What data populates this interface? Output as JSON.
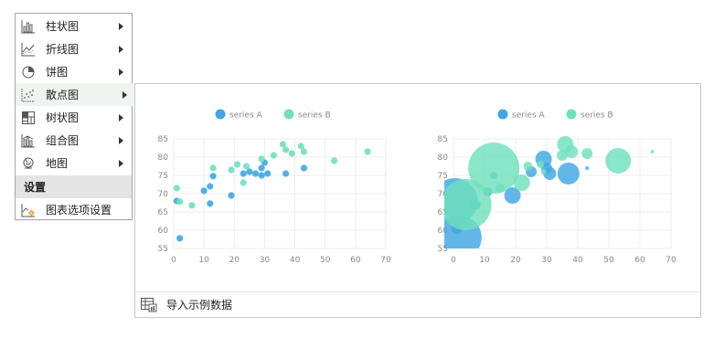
{
  "menu": {
    "items": [
      {
        "label": "柱状图",
        "icon": "bar-chart-icon",
        "has_submenu": true
      },
      {
        "label": "折线图",
        "icon": "line-chart-icon",
        "has_submenu": true
      },
      {
        "label": "饼图",
        "icon": "pie-chart-icon",
        "has_submenu": true
      },
      {
        "label": "散点图",
        "icon": "scatter-chart-icon",
        "has_submenu": true,
        "active": true
      },
      {
        "label": "树状图",
        "icon": "treemap-chart-icon",
        "has_submenu": true
      },
      {
        "label": "组合图",
        "icon": "combo-chart-icon",
        "has_submenu": true
      },
      {
        "label": "地图",
        "icon": "map-globe-icon",
        "has_submenu": true
      }
    ],
    "section_label": "设置",
    "settings_item": {
      "label": "图表选项设置",
      "icon": "chart-settings-icon"
    }
  },
  "panel": {
    "footer_label": "导入示例数据",
    "footer_icon": "import-table-icon"
  },
  "colors": {
    "series_a": "#3fa7e3",
    "series_b": "#6fe0bd",
    "active_bg": "#eef5f0",
    "section_bg": "#e4e4e4"
  },
  "chart_data": [
    {
      "type": "scatter",
      "title": "",
      "legend": [
        "series A",
        "series B"
      ],
      "legend_position": "top-center",
      "xlim": [
        0,
        70
      ],
      "ylim": [
        55,
        85
      ],
      "x_ticks": [
        "0",
        "10",
        "20",
        "30",
        "40",
        "50",
        "60",
        "70"
      ],
      "y_ticks": [
        "55",
        "60",
        "65",
        "70",
        "75",
        "80",
        "85"
      ],
      "grid": true,
      "series": [
        {
          "name": "series A",
          "points": [
            [
              1,
              68
            ],
            [
              2,
              57.8
            ],
            [
              10,
              70.8
            ],
            [
              12,
              67.3
            ],
            [
              12,
              72
            ],
            [
              13,
              74.8
            ],
            [
              19,
              69.5
            ],
            [
              23,
              75.5
            ],
            [
              25,
              76
            ],
            [
              27,
              75.5
            ],
            [
              29,
              77
            ],
            [
              29,
              75
            ],
            [
              30,
              78.5
            ],
            [
              31,
              75.5
            ],
            [
              37,
              75.5
            ],
            [
              43,
              77
            ]
          ]
        },
        {
          "name": "series B",
          "points": [
            [
              1,
              71.5
            ],
            [
              2,
              67.8
            ],
            [
              6,
              66.8
            ],
            [
              13,
              77
            ],
            [
              19,
              76.5
            ],
            [
              21,
              78
            ],
            [
              23,
              73
            ],
            [
              24,
              77.5
            ],
            [
              29,
              79.5
            ],
            [
              33,
              80.5
            ],
            [
              36,
              83.5
            ],
            [
              37,
              82
            ],
            [
              39,
              81
            ],
            [
              42,
              83
            ],
            [
              43,
              81.5
            ],
            [
              53,
              79
            ],
            [
              64,
              81.5
            ]
          ]
        }
      ]
    },
    {
      "type": "scatter",
      "title": "",
      "legend": [
        "series A",
        "series B"
      ],
      "legend_position": "top-center",
      "xlim": [
        0,
        70
      ],
      "ylim": [
        55,
        85
      ],
      "x_ticks": [
        "0",
        "10",
        "20",
        "30",
        "40",
        "50",
        "60",
        "70"
      ],
      "y_ticks": [
        "55",
        "60",
        "65",
        "70",
        "75",
        "80",
        "85"
      ],
      "grid": true,
      "bubble": true,
      "series": [
        {
          "name": "series A",
          "points": [
            [
              0.5,
              68,
              25
            ],
            [
              1,
              60.5,
              6
            ],
            [
              2,
              58,
              24
            ],
            [
              7,
              67,
              6
            ],
            [
              11,
              70.5,
              5
            ],
            [
              13,
              75,
              4
            ],
            [
              19,
              69.5,
              9
            ],
            [
              25,
              76,
              6
            ],
            [
              29,
              79.5,
              9
            ],
            [
              30,
              77,
              6
            ],
            [
              31,
              75.5,
              7
            ],
            [
              37,
              75.5,
              12
            ],
            [
              43,
              77,
              2
            ]
          ]
        },
        {
          "name": "series B",
          "points": [
            [
              4,
              67,
              28
            ],
            [
              13,
              77,
              28
            ],
            [
              15,
              71.5,
              5
            ],
            [
              22,
              73,
              9
            ],
            [
              24,
              77.5,
              5
            ],
            [
              28,
              78,
              4
            ],
            [
              29,
              76,
              3
            ],
            [
              35,
              80.5,
              6
            ],
            [
              36,
              83.5,
              9
            ],
            [
              38,
              81.5,
              7
            ],
            [
              43,
              81,
              6
            ],
            [
              53,
              79,
              14
            ],
            [
              64,
              81.5,
              2
            ]
          ]
        }
      ]
    }
  ]
}
